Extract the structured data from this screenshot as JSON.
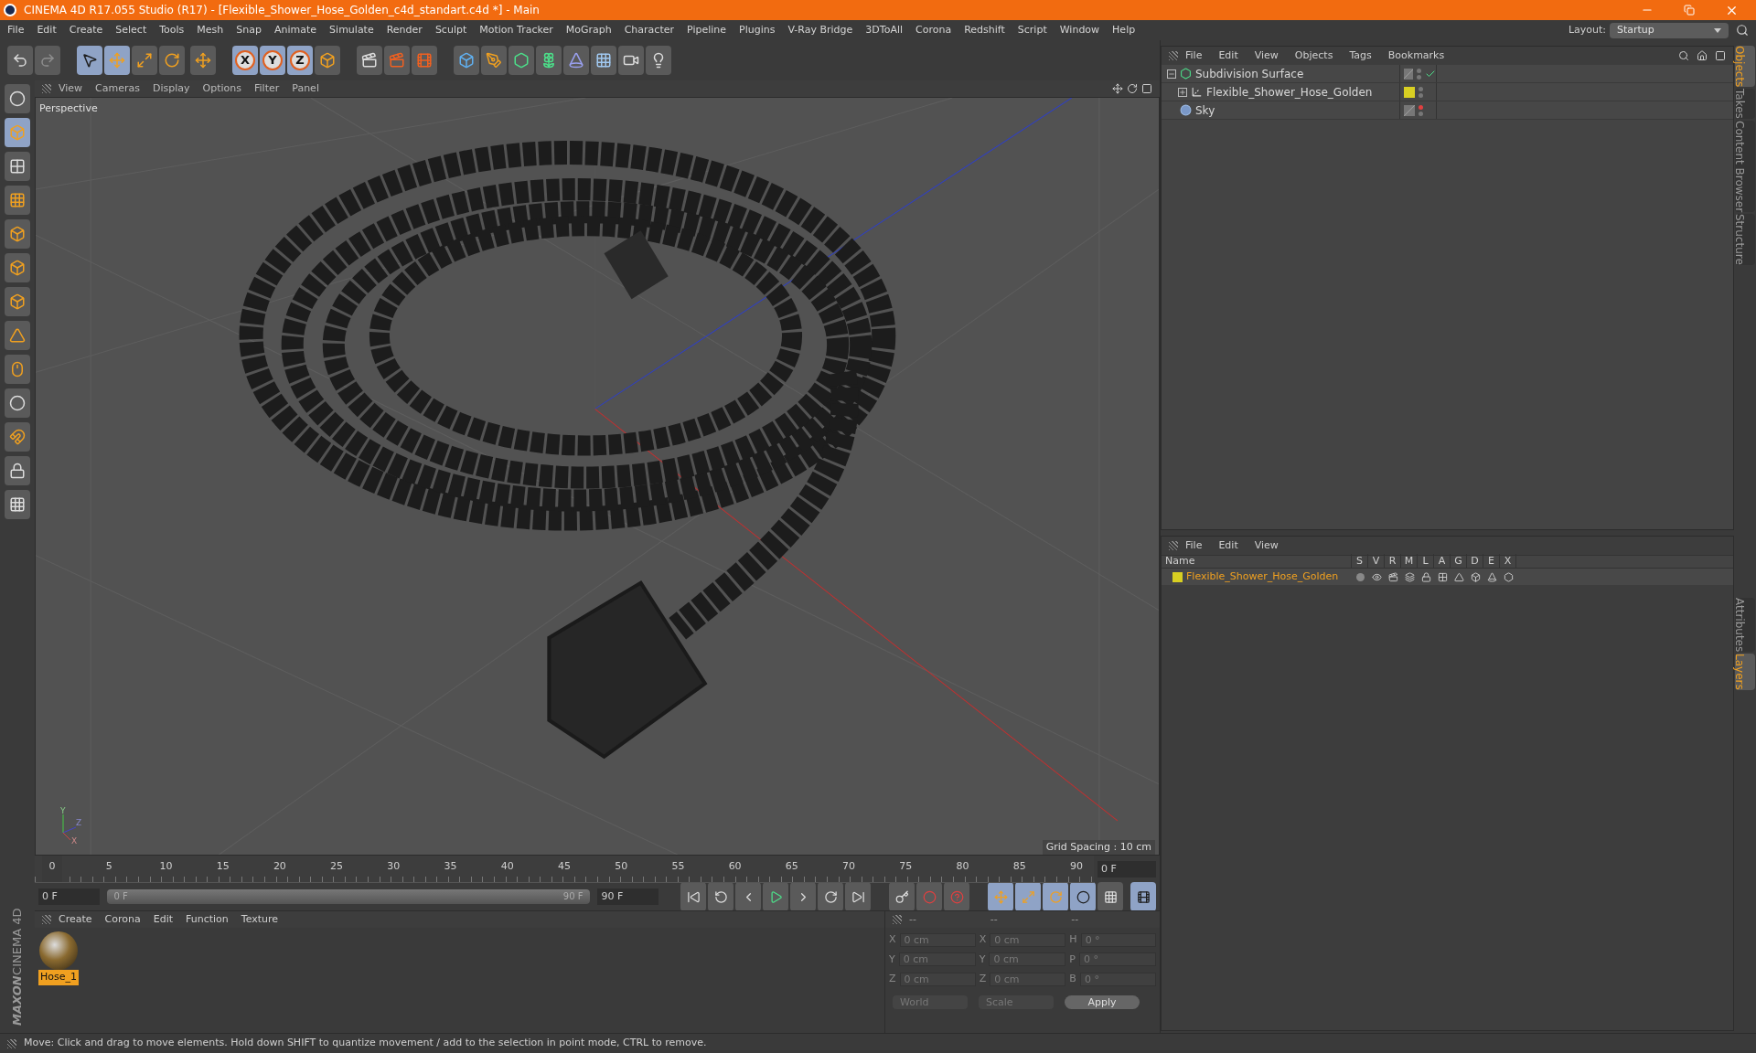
{
  "window": {
    "title": "CINEMA 4D R17.055 Studio (R17) - [Flexible_Shower_Hose_Golden_c4d_standart.c4d *] - Main"
  },
  "menu": [
    "File",
    "Edit",
    "Create",
    "Select",
    "Tools",
    "Mesh",
    "Snap",
    "Animate",
    "Simulate",
    "Render",
    "Sculpt",
    "Motion Tracker",
    "MoGraph",
    "Character",
    "Pipeline",
    "Plugins",
    "V-Ray Bridge",
    "3DToAll",
    "Corona",
    "Redshift",
    "Script",
    "Window",
    "Help"
  ],
  "layout": {
    "label": "Layout:",
    "value": "Startup"
  },
  "toolbar": {
    "axes": [
      "X",
      "Y",
      "Z"
    ]
  },
  "viewport": {
    "menu": [
      "View",
      "Cameras",
      "Display",
      "Options",
      "Filter",
      "Panel"
    ],
    "camera": "Perspective",
    "grid_spacing": "Grid Spacing : 10 cm",
    "gizmo": [
      "Y",
      "Z",
      "X"
    ]
  },
  "timeline": {
    "ticks": [
      "0",
      "5",
      "10",
      "15",
      "20",
      "25",
      "30",
      "35",
      "40",
      "45",
      "50",
      "55",
      "60",
      "65",
      "70",
      "75",
      "80",
      "85",
      "90"
    ],
    "frame_field": "0 F",
    "start_field": "0 F",
    "range_start": "0 F",
    "range_end": "90 F",
    "range_slider": {
      "level": 1
    },
    "end_field": "90 F"
  },
  "materials": {
    "menu": [
      "Create",
      "Corona",
      "Edit",
      "Function",
      "Texture"
    ],
    "items": [
      {
        "name": "Hose_1",
        "selected": true
      }
    ]
  },
  "coordinates": {
    "headers": [
      "--",
      "--",
      "--"
    ],
    "rows": [
      {
        "a": "X",
        "a_value": "0 cm",
        "b": "X",
        "b_value": "0 cm",
        "c": "H",
        "c_value": "0 °"
      },
      {
        "a": "Y",
        "a_value": "0 cm",
        "b": "Y",
        "b_value": "0 cm",
        "c": "P",
        "c_value": "0 °"
      },
      {
        "a": "Z",
        "a_value": "0 cm",
        "b": "Z",
        "b_value": "0 cm",
        "c": "B",
        "c_value": "0 °"
      }
    ],
    "space": "World",
    "mode": "Scale",
    "apply": "Apply"
  },
  "status_bar": "Move: Click and drag to move elements. Hold down SHIFT to quantize movement / add to the selection in point mode, CTRL to remove.",
  "objects": {
    "menu": [
      "File",
      "Edit",
      "View",
      "Objects",
      "Tags",
      "Bookmarks"
    ],
    "tree": [
      {
        "name": "Subdivision Surface",
        "kind": "subdivision",
        "expanded": true,
        "checked": true,
        "render_off": false,
        "children": [
          {
            "name": "Flexible_Shower_Hose_Golden",
            "kind": "null",
            "expanded": false,
            "checked": false,
            "render_off": false,
            "color": "#d8cf22"
          }
        ]
      },
      {
        "name": "Sky",
        "kind": "sky",
        "checked": false,
        "render_off": true
      }
    ]
  },
  "layers": {
    "menu": [
      "File",
      "Edit",
      "View"
    ],
    "columns": [
      "Name",
      "S",
      "V",
      "R",
      "M",
      "L",
      "A",
      "G",
      "D",
      "E",
      "X"
    ],
    "rows": [
      {
        "name": "Flexible_Shower_Hose_Golden",
        "color": "#d8cf22"
      }
    ]
  },
  "side_tabs": {
    "top": [
      {
        "label": "Objects",
        "selected": true
      },
      {
        "label": "Takes",
        "selected": false
      },
      {
        "label": "Content Browser",
        "selected": false
      },
      {
        "label": "Structure",
        "selected": false
      }
    ],
    "bottom": [
      {
        "label": "Attributes",
        "selected": false
      },
      {
        "label": "Layers",
        "selected": true
      }
    ]
  },
  "logo": {
    "brand": "MAXON",
    "product": "CINEMA 4D"
  }
}
